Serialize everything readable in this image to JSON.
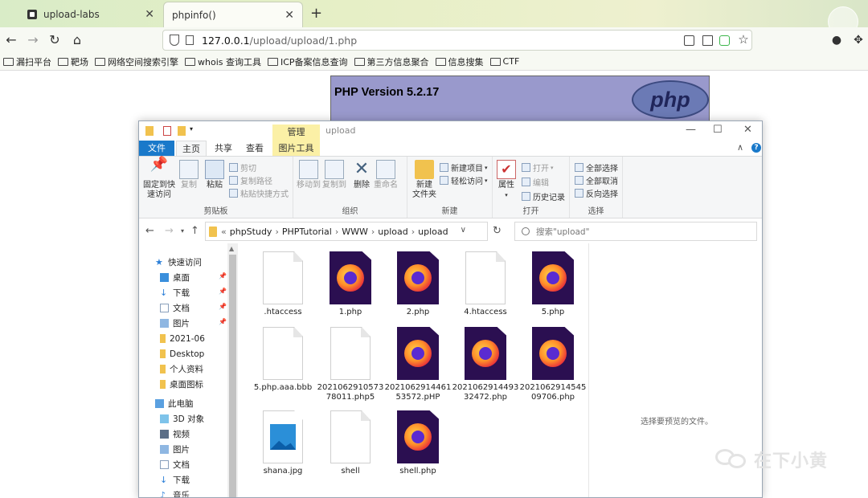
{
  "browser": {
    "tabs": [
      {
        "title": "upload-labs",
        "active": false
      },
      {
        "title": "phpinfo()",
        "active": true
      }
    ],
    "url_host": "127.0.0.1",
    "url_path": "/upload/upload/1.php",
    "bookmarks": [
      "漏扫平台",
      "靶场",
      "网络空间搜索引擎",
      "whois 查询工具",
      "ICP备案信息查询",
      "第三方信息聚合",
      "信息搜集",
      "CTF"
    ]
  },
  "phpinfo": {
    "title": "PHP Version 5.2.17",
    "logo_text": "php",
    "bg_color": "#9999cc"
  },
  "explorer": {
    "title": "upload",
    "manage_tab": "管理",
    "ribbon_tabs": {
      "file": "文件",
      "home": "主页",
      "share": "共享",
      "view": "查看",
      "picture_tools": "图片工具"
    },
    "ribbon": {
      "clipboard": {
        "label": "剪贴板",
        "pin": "固定到快\n速访问",
        "copy": "复制",
        "paste": "粘贴",
        "cut": "剪切",
        "copy_path": "复制路径",
        "paste_shortcut": "粘贴快捷方式"
      },
      "organize": {
        "label": "组织",
        "move_to": "移动到",
        "copy_to": "复制到",
        "delete": "删除",
        "rename": "重命名"
      },
      "new": {
        "label": "新建",
        "new_folder": "新建\n文件夹",
        "new_item": "新建项目",
        "easy_access": "轻松访问"
      },
      "open": {
        "label": "打开",
        "properties": "属性",
        "open": "打开",
        "edit": "编辑",
        "history": "历史记录"
      },
      "select": {
        "label": "选择",
        "select_all": "全部选择",
        "select_none": "全部取消",
        "invert": "反向选择"
      }
    },
    "breadcrumb": [
      "phpStudy",
      "PHPTutorial",
      "WWW",
      "upload",
      "upload"
    ],
    "search_placeholder": "搜索\"upload\"",
    "nav": {
      "quick_access": "快速访问",
      "items": [
        "桌面",
        "下载",
        "文档",
        "图片",
        "2021-06",
        "Desktop",
        "个人资料",
        "桌面图标"
      ],
      "this_pc": "此电脑",
      "pc_items": [
        "3D 对象",
        "视频",
        "图片",
        "文档",
        "下载",
        "音乐"
      ]
    },
    "files": [
      {
        "name": ".htaccess",
        "type": "blank"
      },
      {
        "name": "1.php",
        "type": "firefox"
      },
      {
        "name": "2.php",
        "type": "firefox"
      },
      {
        "name": "4.htaccess",
        "type": "blank"
      },
      {
        "name": "5.php",
        "type": "firefox"
      },
      {
        "name": "5.php.aaa.bbb",
        "type": "blank"
      },
      {
        "name": "202106291057378011.php5",
        "type": "blank"
      },
      {
        "name": "202106291446153572.pHP",
        "type": "firefox"
      },
      {
        "name": "202106291449332472.php",
        "type": "firefox"
      },
      {
        "name": "202106291454509706.php",
        "type": "firefox"
      },
      {
        "name": "shana.jpg",
        "type": "image"
      },
      {
        "name": "shell",
        "type": "blank"
      },
      {
        "name": "shell.php",
        "type": "firefox"
      }
    ],
    "preview_text": "选择要预览的文件。"
  },
  "watermark": {
    "text": "在下小黄"
  }
}
